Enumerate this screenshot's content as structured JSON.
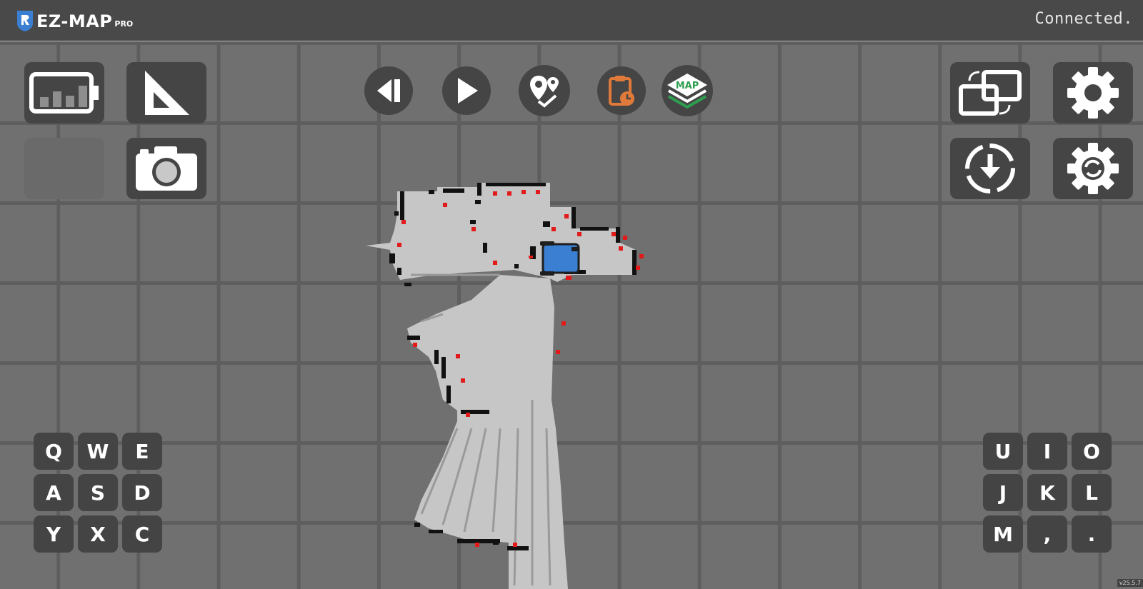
{
  "app": {
    "name": "EZ-MAP",
    "edition": "PRO"
  },
  "status": {
    "text": "Connected."
  },
  "left_toolbar": [
    {
      "icon": "battery-icon"
    },
    {
      "icon": "ruler-triangle-icon"
    },
    {
      "icon": "empty-slot"
    },
    {
      "icon": "camera-icon"
    }
  ],
  "center_toolbar": [
    {
      "icon": "step-back-icon"
    },
    {
      "icon": "play-icon"
    },
    {
      "icon": "waypoints-icon"
    },
    {
      "icon": "clipboard-clock-icon"
    },
    {
      "icon": "map-layers-icon",
      "label": "MAP"
    }
  ],
  "right_toolbar": [
    {
      "icon": "switch-screens-icon"
    },
    {
      "icon": "gear-icon"
    },
    {
      "icon": "download-circle-icon"
    },
    {
      "icon": "gear-sync-icon"
    }
  ],
  "left_keypad": [
    "Q",
    "W",
    "E",
    "A",
    "S",
    "D",
    "Y",
    "X",
    "C"
  ],
  "right_keypad": [
    "U",
    "I",
    "O",
    "J",
    "K",
    "L",
    "M",
    ",",
    "."
  ],
  "colors": {
    "accent_orange": "#e07a3a",
    "map_green": "#2e9e4f",
    "robot_blue": "#3a7fd1",
    "obstacle_red": "#e21a1a",
    "free_space": "#c6c6c6"
  },
  "version": "v25.5.7"
}
